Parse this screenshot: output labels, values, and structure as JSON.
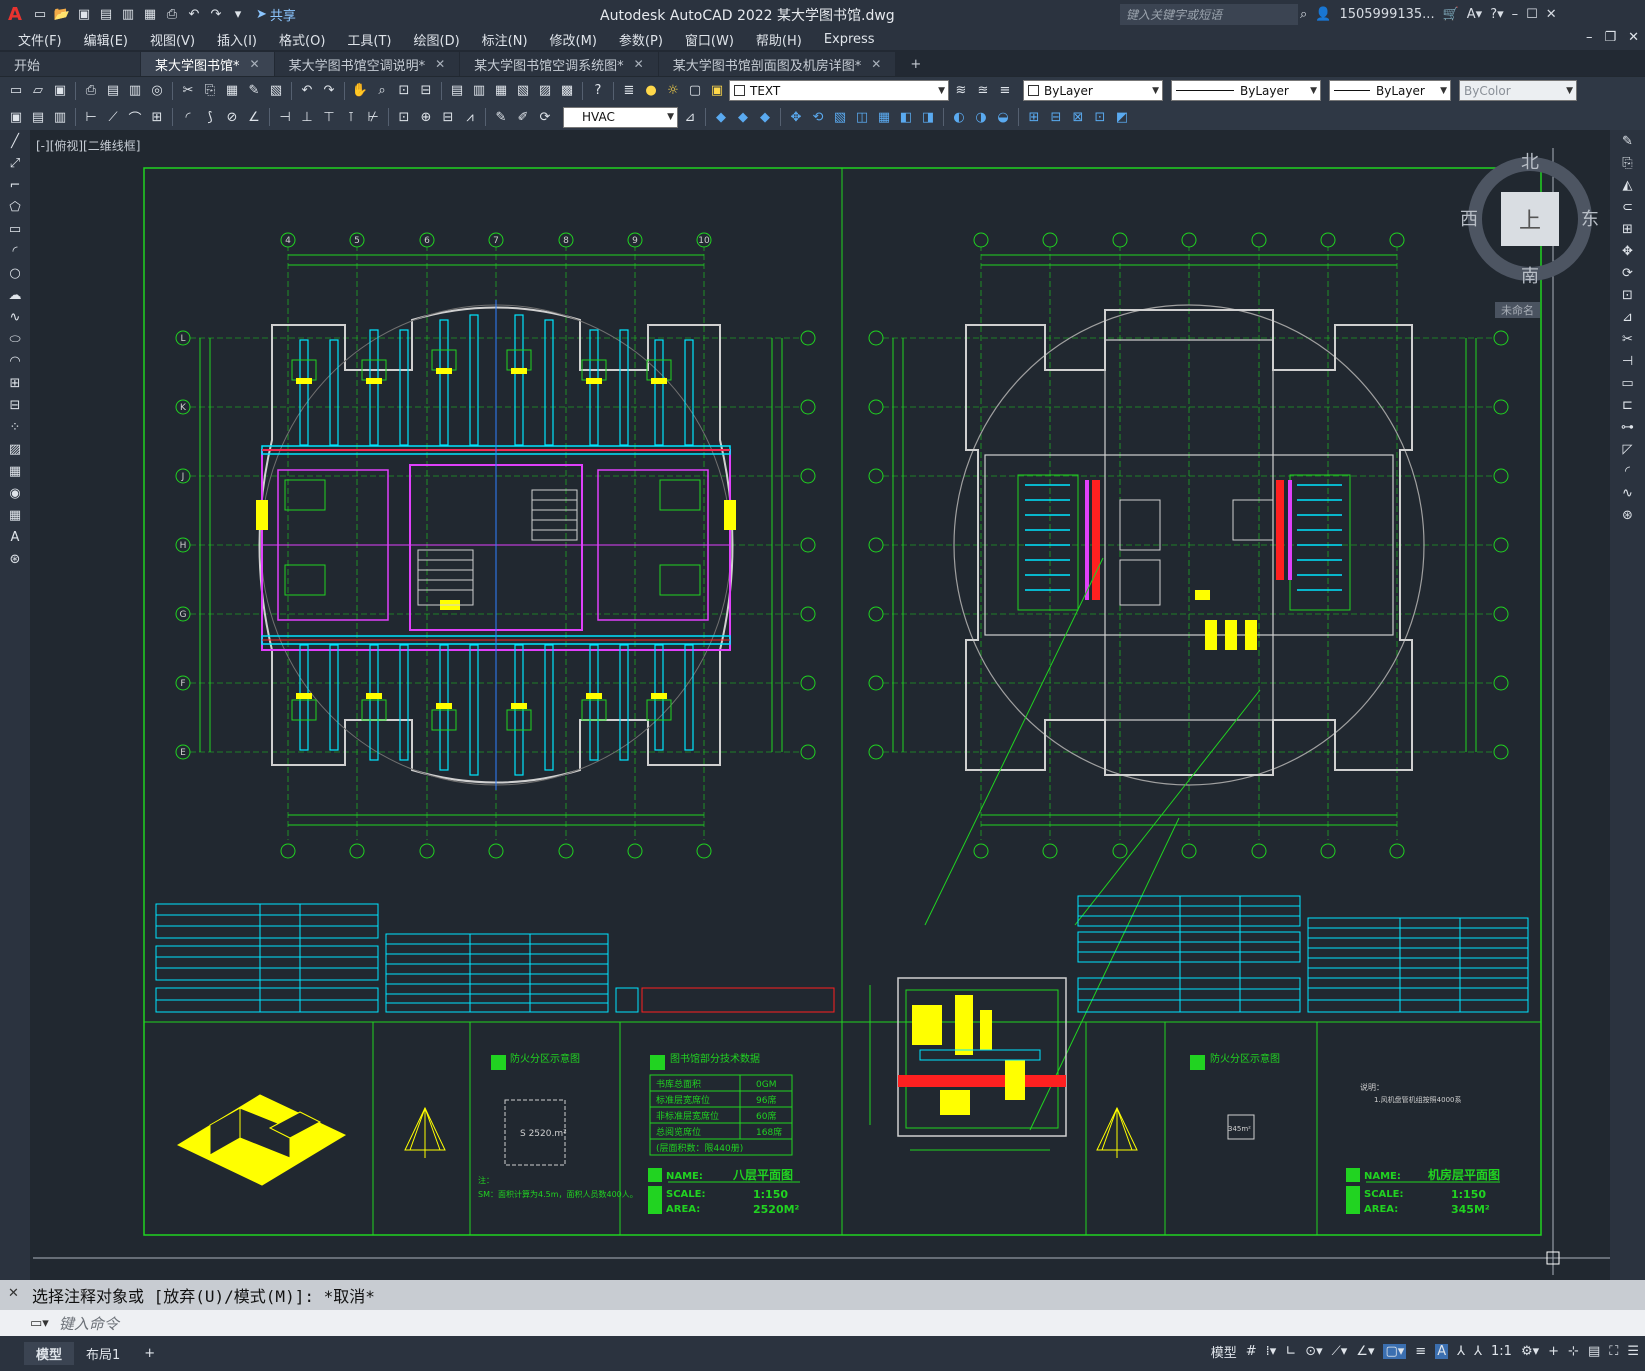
{
  "titlebar": {
    "logo": "A",
    "share": "共享",
    "title": "Autodesk AutoCAD 2022    某大学图书馆.dwg",
    "search_placeholder": "键入关键字或短语",
    "user": "1505999135..."
  },
  "menu": [
    "文件(F)",
    "编辑(E)",
    "视图(V)",
    "插入(I)",
    "格式(O)",
    "工具(T)",
    "绘图(D)",
    "标注(N)",
    "修改(M)",
    "参数(P)",
    "窗口(W)",
    "帮助(H)",
    "Express"
  ],
  "tabs": [
    {
      "label": "开始",
      "active": false,
      "closable": false
    },
    {
      "label": "某大学图书馆*",
      "active": true,
      "closable": true
    },
    {
      "label": "某大学图书馆空调说明*",
      "active": false,
      "closable": true
    },
    {
      "label": "某大学图书馆空调系统图*",
      "active": false,
      "closable": true
    },
    {
      "label": "某大学图书馆剖面图及机房详图*",
      "active": false,
      "closable": true
    }
  ],
  "toolbar": {
    "text_style": "TEXT",
    "layer": "ByLayer",
    "linetype": "ByLayer",
    "lineweight": "ByLayer",
    "color": "ByColor",
    "dim_style": "HVAC"
  },
  "view_label": "[-][俯视][二维线框]",
  "viewcube": {
    "north": "北",
    "south": "南",
    "east": "东",
    "west": "西",
    "face": "上",
    "named": "未命名"
  },
  "drawing": {
    "plan1": {
      "name": "八层平面图",
      "scale": "1:150",
      "area": "2520M²",
      "grid_cols": [
        "4",
        "5",
        "6",
        "7",
        "8",
        "9",
        "10"
      ],
      "grid_rows": [
        "L",
        "K",
        "J",
        "H",
        "G",
        "F",
        "E"
      ]
    },
    "plan2": {
      "name": "机房层平面图",
      "scale": "1:150",
      "area": "345M²"
    },
    "title_labels": {
      "name": "NAME:",
      "scale": "SCALE:",
      "area": "AREA:"
    },
    "fire_zone_title": "防火分区示意图",
    "tech_table_title": "图书馆部分技术数据",
    "tech_rows": [
      [
        "书库总面积",
        "0GM"
      ],
      [
        "标准层宽席位",
        "96席"
      ],
      [
        "非标准层宽席位",
        "60席"
      ],
      [
        "总阅览席位",
        "168席"
      ]
    ],
    "tech_footer": "(层面积数：限440册)",
    "fire_area": "S 2520.m²",
    "fire_area2": "345m²",
    "note": "注：",
    "note_text": "SM：面积计算为4.5m，面积人员数400人。",
    "note2_title": "说明：",
    "note2_text": "1.风机盘管机组按照4000系"
  },
  "command": {
    "history": "选择注释对象或 [放弃(U)/模式(M)]: *取消*",
    "placeholder": "键入命令"
  },
  "status": {
    "tabs": [
      "模型",
      "布局1"
    ],
    "model_label": "模型",
    "scale": "1:1"
  },
  "colors": {
    "accent": "#8cc6ff",
    "bg": "#212830",
    "cad_green": "#21d321",
    "cad_cyan": "#00e5ff",
    "cad_magenta": "#e040fb",
    "cad_yellow": "#ffff00",
    "cad_red": "#ff2020",
    "cad_white": "#d0d0d0"
  }
}
